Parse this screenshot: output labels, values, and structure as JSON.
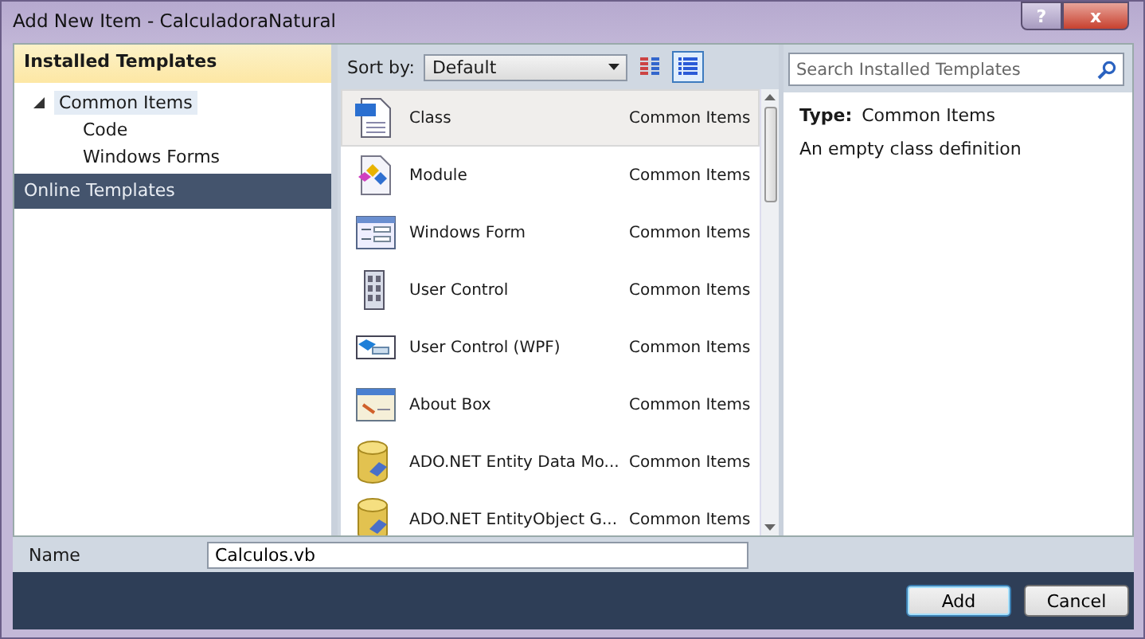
{
  "window": {
    "title": "Add New Item - CalculadoraNatural",
    "buttons": [
      "?",
      "x"
    ]
  },
  "sidebar": {
    "installed_header": "Installed Templates",
    "tree": [
      {
        "label": "Common Items",
        "expanded": true,
        "selected": true,
        "children": [
          {
            "label": "Code",
            "selected": false
          },
          {
            "label": "Windows Forms",
            "selected": false
          }
        ]
      }
    ],
    "online_header": "Online Templates"
  },
  "toolbar": {
    "sort_label": "Sort by:",
    "sort_value": "Default",
    "views": [
      {
        "kind": "medium",
        "selected": false
      },
      {
        "kind": "list",
        "selected": true
      }
    ]
  },
  "search": {
    "placeholder": "Search Installed Templates"
  },
  "templates": [
    {
      "kind": "class",
      "name": "Class",
      "category": "Common Items",
      "selected": true
    },
    {
      "kind": "module",
      "name": "Module",
      "category": "Common Items",
      "selected": false
    },
    {
      "kind": "form",
      "name": "Windows Form",
      "category": "Common Items",
      "selected": false
    },
    {
      "kind": "usercontrol",
      "name": "User Control",
      "category": "Common Items",
      "selected": false
    },
    {
      "kind": "wpf",
      "name": "User Control (WPF)",
      "category": "Common Items",
      "selected": false
    },
    {
      "kind": "aboutbox",
      "name": "About Box",
      "category": "Common Items",
      "selected": false
    },
    {
      "kind": "database",
      "name": "ADO.NET Entity Data Mo...",
      "category": "Common Items",
      "selected": false
    },
    {
      "kind": "database",
      "name": "ADO.NET EntityObject G...",
      "category": "Common Items",
      "selected": false
    }
  ],
  "details": {
    "type_label": "Type:",
    "type_value": "Common Items",
    "description": "An empty class definition"
  },
  "name_field": {
    "label": "Name",
    "value": "Calculos.vb"
  },
  "buttons": [
    "Add",
    "Cancel"
  ]
}
